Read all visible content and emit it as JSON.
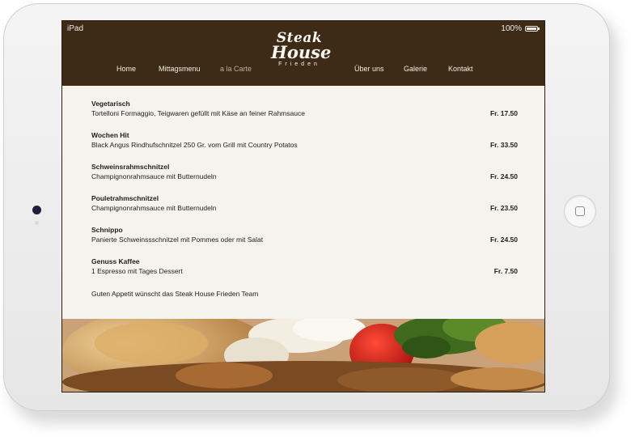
{
  "status_bar": {
    "device": "iPad",
    "battery": "100%"
  },
  "logo": {
    "line1": "Steak",
    "line2": "House",
    "line3": "Frieden"
  },
  "nav": [
    {
      "label": "Home",
      "active": false
    },
    {
      "label": "Mittagsmenu",
      "active": false
    },
    {
      "label": "a la Carte",
      "active": true
    },
    {
      "label": "Über uns",
      "active": false
    },
    {
      "label": "Galerie",
      "active": false
    },
    {
      "label": "Kontakt",
      "active": false
    }
  ],
  "menu_items": [
    {
      "title": "Vegetarisch",
      "description": "Tortelloni Formaggio, Teigwaren gefüllt mit Käse an feiner Rahmsauce",
      "price": "Fr.  17.50"
    },
    {
      "title": "Wochen Hit",
      "description": "Black Angus Rindhufschnitzel 250 Gr. vom Grill mit Country Potatos",
      "price": "Fr.  33.50"
    },
    {
      "title": "Schweinsrahmschnitzel",
      "description": "Champignonrahmsauce mit Butternudeln",
      "price": "Fr. 24.50"
    },
    {
      "title": "Pouletrahmschnitzel",
      "description": "Champignonrahmsauce mit Butternudeln",
      "price": "Fr.  23.50"
    },
    {
      "title": "Schnippo",
      "description": "Panierte Schweinssschnitzel mit Pommes oder mit Salat",
      "price": "Fr.  24.50"
    },
    {
      "title": "Genuss Kaffee",
      "description": "1 Espresso mit Tages Dessert",
      "price": "Fr. 7.50"
    }
  ],
  "footer_note": "Guten Appetit wünscht das Steak House Frieden Team",
  "colors": {
    "header_bg": "#3d2a17",
    "content_bg": "#f5f3ee",
    "nav_active": "#bfb09b"
  }
}
